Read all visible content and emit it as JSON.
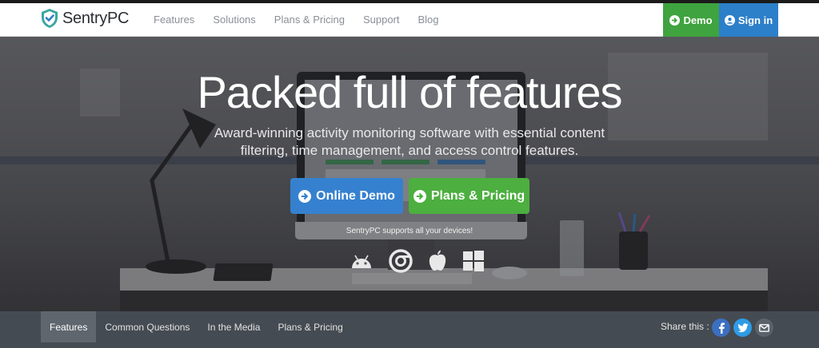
{
  "brand": {
    "name": "SentryPC"
  },
  "nav": {
    "links": [
      "Features",
      "Solutions",
      "Plans & Pricing",
      "Support",
      "Blog"
    ],
    "demo_label": "Demo",
    "signin_label": "Sign in"
  },
  "hero": {
    "headline": "Packed full of features",
    "subtitle": "Award-winning activity monitoring software with essential content filtering, time management, and access control features.",
    "cta_demo": "Online Demo",
    "cta_plans": "Plans & Pricing",
    "supports_text": "SentryPC supports all your devices!",
    "devices": [
      "android-icon",
      "chrome-icon",
      "apple-icon",
      "windows-icon"
    ]
  },
  "subnav": {
    "items": [
      "Features",
      "Common Questions",
      "In the Media",
      "Plans & Pricing"
    ],
    "active": "Features",
    "share_label": "Share this :",
    "share_icons": [
      "facebook-icon",
      "twitter-icon",
      "email-icon"
    ]
  },
  "colors": {
    "demo_green": "#3fa33f",
    "signin_blue": "#2c7fc9",
    "cta_blue": "#3581cf",
    "cta_green": "#4caf3f",
    "subnav_bg": "#454b52",
    "facebook": "#3b6fc0",
    "twitter": "#2f9be6",
    "email": "#5b626a"
  }
}
